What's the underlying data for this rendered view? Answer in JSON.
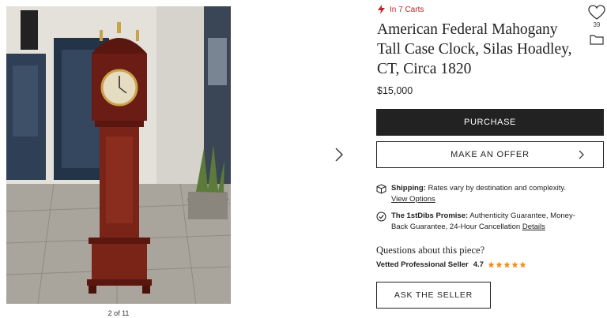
{
  "gallery": {
    "counter": "2 of 11",
    "image_alt": "American Federal Mahogany Tall Case Clock",
    "next_icon": "chevron-right-icon"
  },
  "listing": {
    "carts_badge": "In 7 Carts",
    "title": "American Federal Mahogany Tall Case Clock, Silas Hoadley, CT, Circa 1820",
    "price": "$15,000",
    "favorites_count": "39"
  },
  "actions": {
    "purchase_label": "PURCHASE",
    "offer_label": "MAKE AN OFFER",
    "ask_label": "ASK THE SELLER"
  },
  "shipping": {
    "label": "Shipping:",
    "text": "Rates vary by destination and complexity.",
    "link": "View Options"
  },
  "promise": {
    "label": "The 1stDibs Promise:",
    "text": "Authenticity Guarantee, Money-Back Guarantee, 24-Hour Cancellation",
    "link": "Details"
  },
  "seller": {
    "questions": "Questions about this piece?",
    "label": "Vetted Professional Seller",
    "rating": "4.7",
    "stars": 5
  },
  "colors": {
    "accent_red": "#c2242c",
    "button_dark": "#222222",
    "star_orange": "#f08c1a"
  }
}
